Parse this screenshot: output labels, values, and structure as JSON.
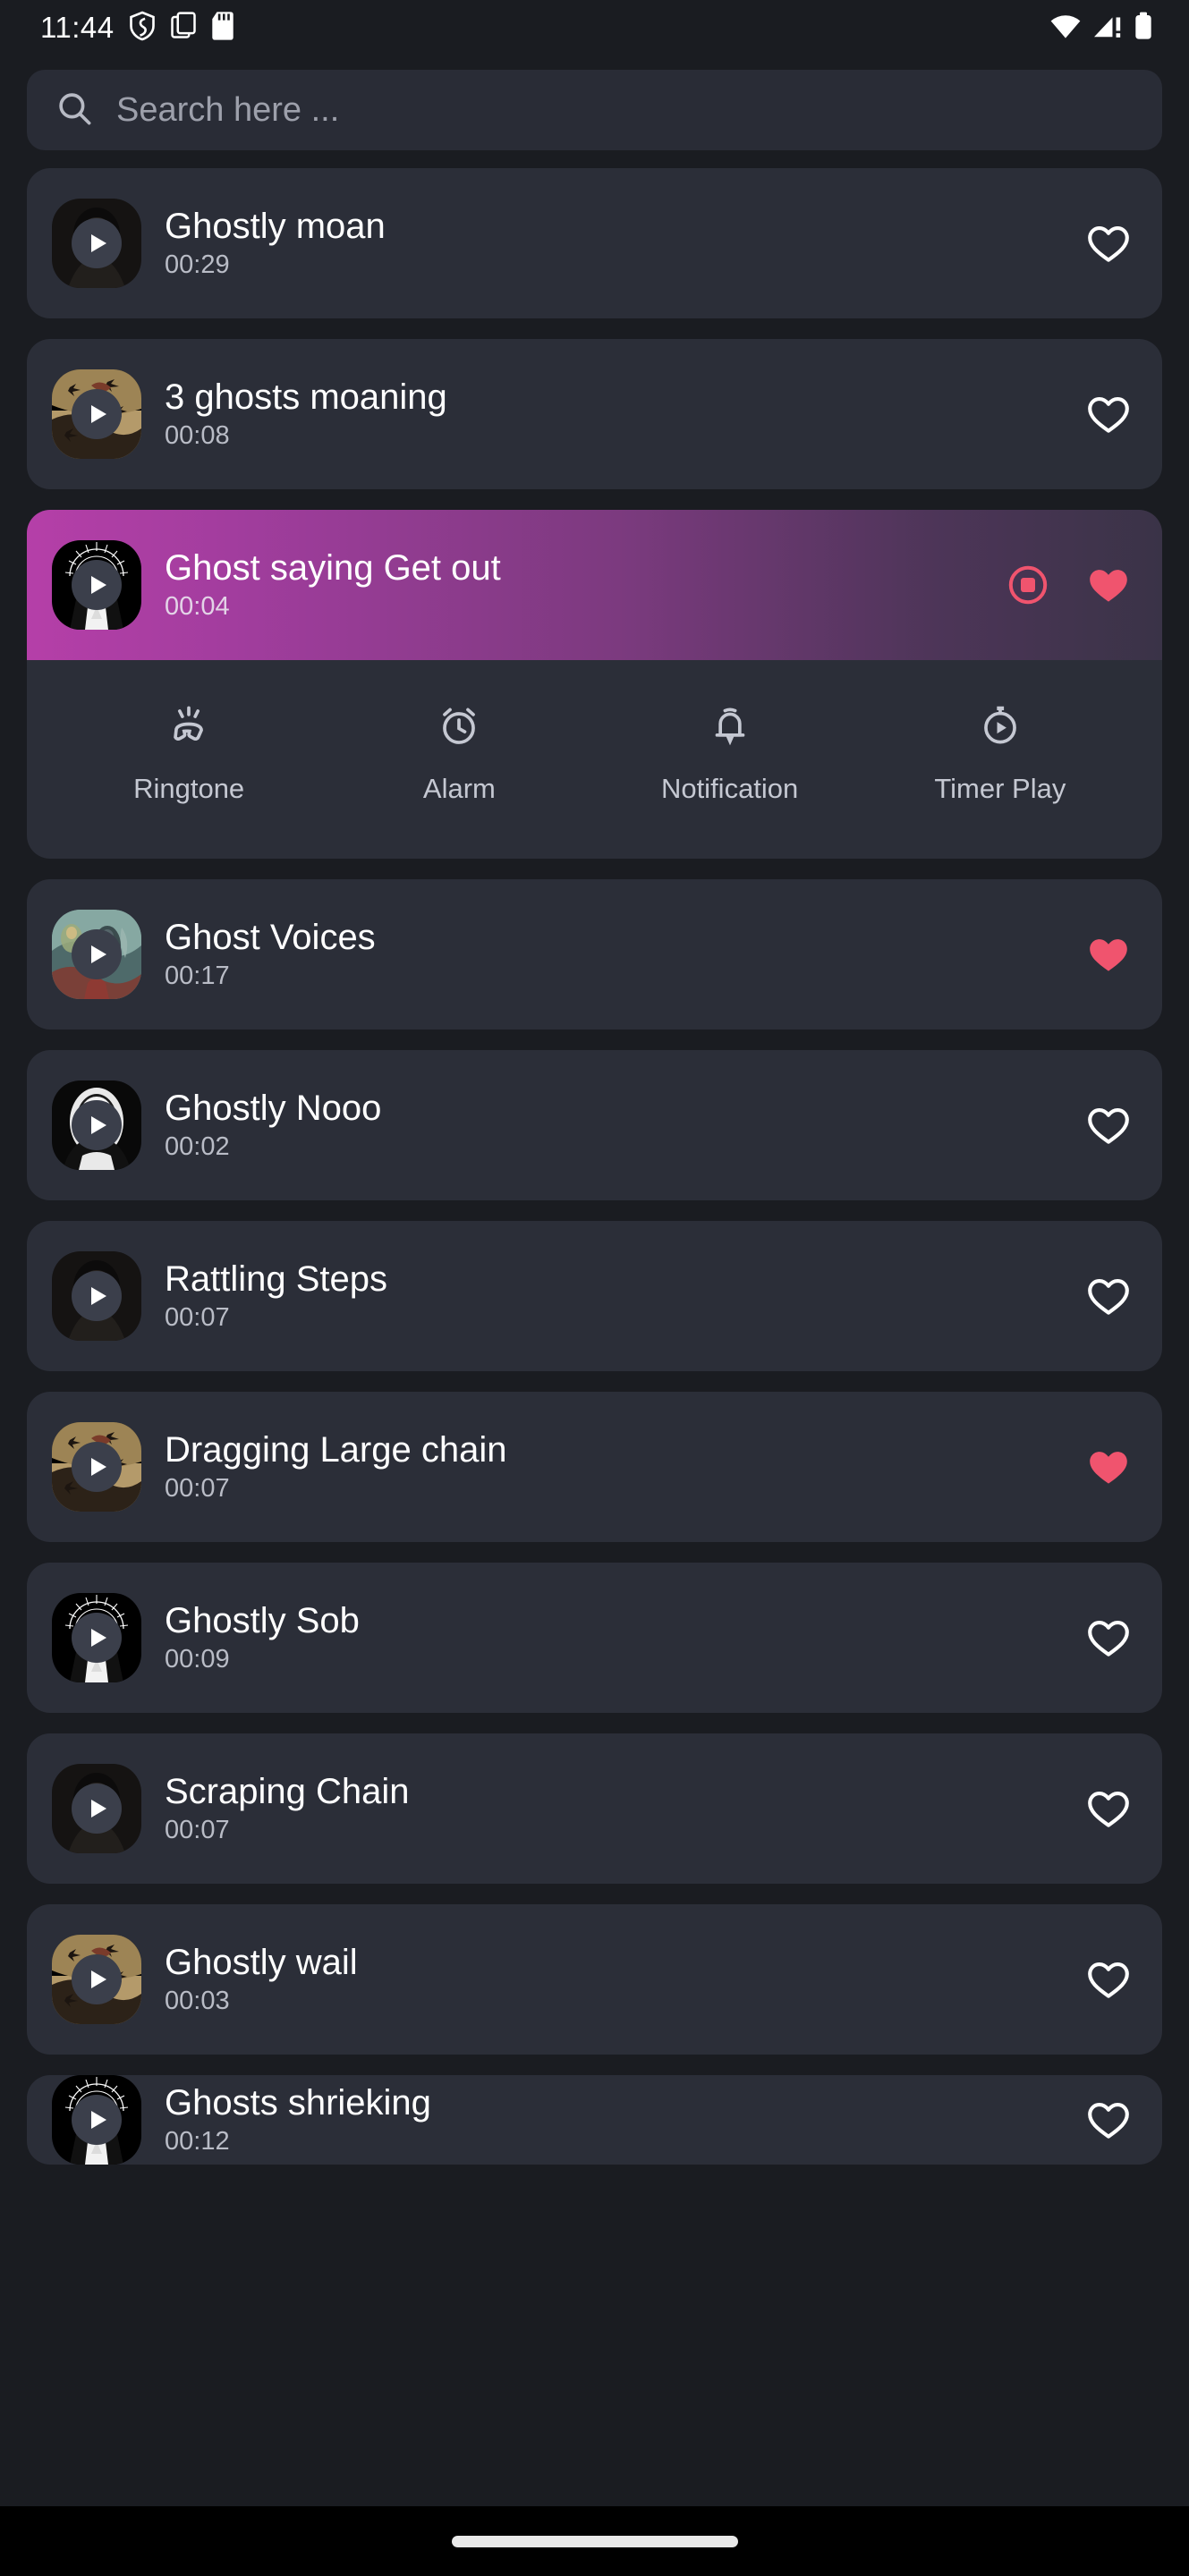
{
  "status_bar": {
    "time": "11:44",
    "left_icons": [
      "shield-icon",
      "copy-icon",
      "sd-card-icon"
    ],
    "right_icons": [
      "wifi-icon",
      "cellular-signal-icon",
      "battery-icon"
    ]
  },
  "search": {
    "placeholder": "Search here ...",
    "value": "",
    "icon": "search-icon"
  },
  "colors": {
    "screen_background": "#1a1c21",
    "card_background": "#2b2e38",
    "search_background": "#292c36",
    "accent_pink": "#f0546e",
    "selected_gradient_start": "#b53fa8",
    "selected_gradient_end": "#3a3347",
    "title_text": "#ffffff",
    "duration_text": "#b9bcc6",
    "nav_pill": "#e9e9e9"
  },
  "action_panel": {
    "visible": true,
    "items": [
      {
        "label": "Ringtone",
        "icon": "ringtone-icon"
      },
      {
        "label": "Alarm",
        "icon": "alarm-clock-icon"
      },
      {
        "label": "Notification",
        "icon": "notification-bell-icon"
      },
      {
        "label": "Timer Play",
        "icon": "timer-play-icon"
      }
    ]
  },
  "sounds": [
    {
      "title": "Ghostly moan",
      "duration": "00:29",
      "favorite": false,
      "playing": false,
      "art": "dark-hooded-figure"
    },
    {
      "title": "3 ghosts moaning",
      "duration": "00:08",
      "favorite": false,
      "playing": false,
      "art": "sepia-crows"
    },
    {
      "title": "Ghost saying Get out",
      "duration": "00:04",
      "favorite": true,
      "playing": true,
      "art": "halo-nun"
    },
    {
      "title": "Ghost Voices",
      "duration": "00:17",
      "favorite": true,
      "playing": false,
      "art": "teal-spirits"
    },
    {
      "title": "Ghostly Nooo",
      "duration": "00:02",
      "favorite": false,
      "playing": false,
      "art": "white-mask-face"
    },
    {
      "title": "Rattling Steps",
      "duration": "00:07",
      "favorite": false,
      "playing": false,
      "art": "dark-hooded-figure"
    },
    {
      "title": "Dragging Large chain",
      "duration": "00:07",
      "favorite": true,
      "playing": false,
      "art": "sepia-crows"
    },
    {
      "title": "Ghostly Sob",
      "duration": "00:09",
      "favorite": false,
      "playing": false,
      "art": "halo-nun"
    },
    {
      "title": "Scraping Chain",
      "duration": "00:07",
      "favorite": false,
      "playing": false,
      "art": "dark-hooded-figure"
    },
    {
      "title": "Ghostly wail",
      "duration": "00:03",
      "favorite": false,
      "playing": false,
      "art": "sepia-crows"
    },
    {
      "title": "Ghosts shrieking",
      "duration": "00:12",
      "favorite": false,
      "playing": false,
      "art": "halo-nun"
    }
  ],
  "playing_controls": {
    "stop_icon": "stop-circle-icon",
    "favorite_icon": "heart-filled-icon"
  },
  "nav_bar": {
    "pill": "home-gesture-pill"
  }
}
